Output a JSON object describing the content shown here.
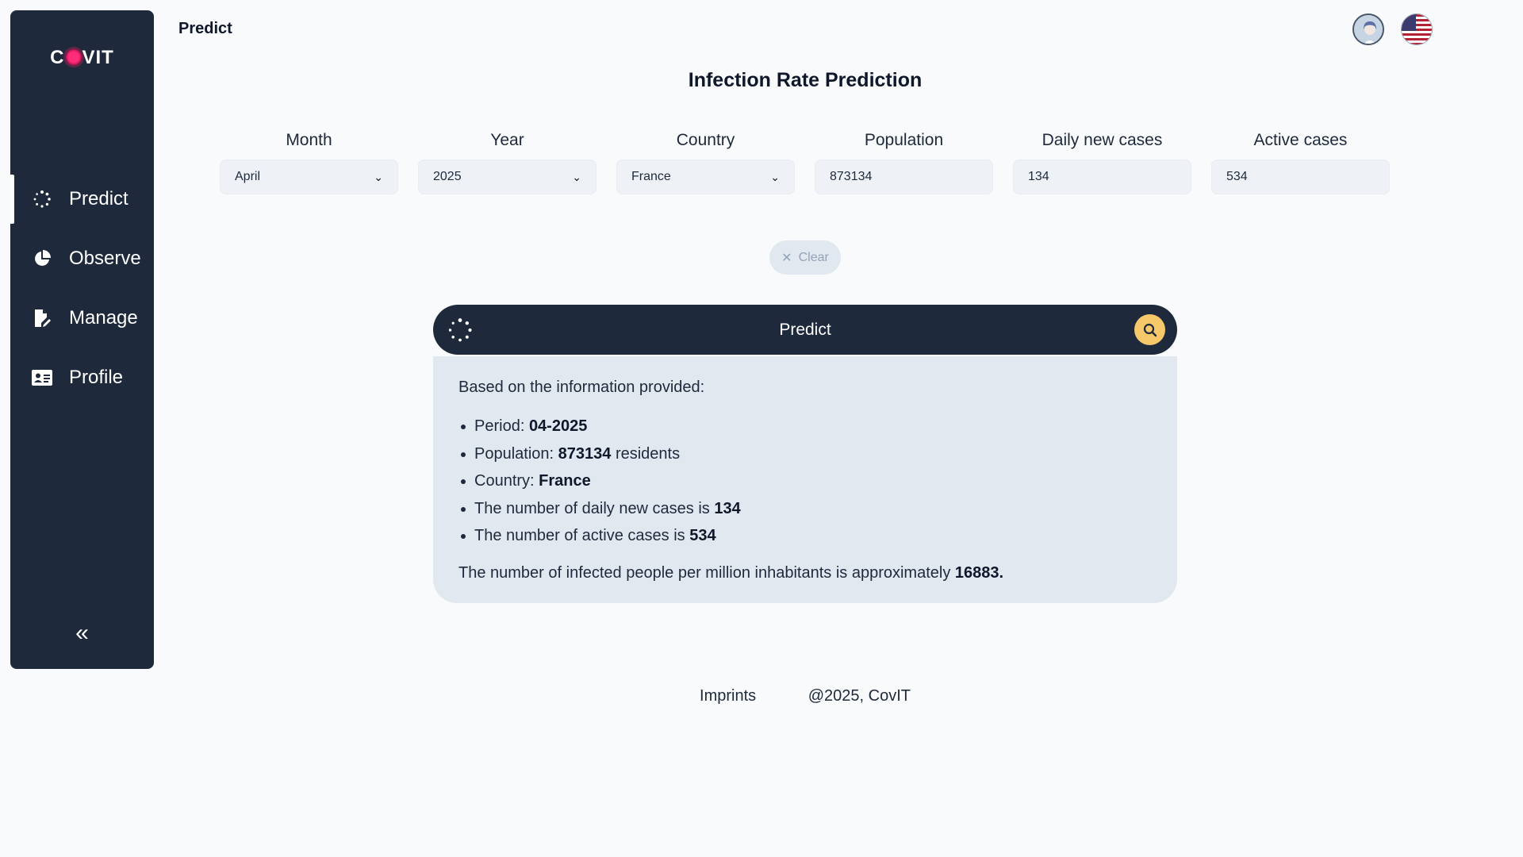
{
  "app": {
    "logo_text_left": "C",
    "logo_text_right": "VIT",
    "page_title": "Predict",
    "heading": "Infection Rate Prediction"
  },
  "sidebar": {
    "items": [
      {
        "label": "Predict",
        "icon": "spinner-icon",
        "active": true
      },
      {
        "label": "Observe",
        "icon": "pie-chart-icon",
        "active": false
      },
      {
        "label": "Manage",
        "icon": "file-edit-icon",
        "active": false
      },
      {
        "label": "Profile",
        "icon": "id-card-icon",
        "active": false
      }
    ],
    "collapse_glyph": "«"
  },
  "form": {
    "month": {
      "label": "Month",
      "value": "April"
    },
    "year": {
      "label": "Year",
      "value": "2025"
    },
    "country": {
      "label": "Country",
      "value": "France"
    },
    "population": {
      "label": "Population",
      "value": "873134"
    },
    "daily_new_cases": {
      "label": "Daily new cases",
      "value": "134"
    },
    "active_cases": {
      "label": "Active cases",
      "value": "534"
    }
  },
  "actions": {
    "clear_label": "Clear",
    "predict_label": "Predict"
  },
  "result": {
    "intro": "Based on the information provided:",
    "period_label": "Period: ",
    "period_value": "04-2025",
    "population_label": "Population: ",
    "population_value": "873134",
    "population_suffix": " residents",
    "country_label": "Country: ",
    "country_value": "France",
    "daily_label": "The number of daily new cases is ",
    "daily_value": "134",
    "active_label": "The number of active cases is ",
    "active_value": "534",
    "summary_label": "The number of infected people per million inhabitants is approximately ",
    "summary_value": "16883."
  },
  "footer": {
    "imprints": "Imprints",
    "copyright": "@2025, CovIT"
  },
  "colors": {
    "sidebar_bg": "#1e293b",
    "accent_search": "#f6c86a",
    "logo_virus": "#e11d63"
  }
}
